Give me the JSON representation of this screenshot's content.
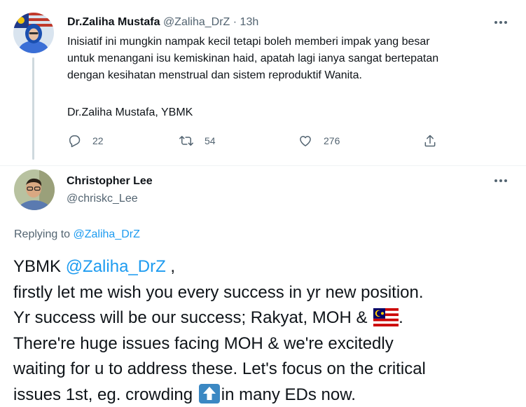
{
  "parent_tweet": {
    "author_name": "Dr.Zaliha Mustafa",
    "author_handle": "@Zaliha_DrZ",
    "separator": "·",
    "time": "13h",
    "text_lines": [
      "Inisiatif ini mungkin nampak kecil tetapi boleh memberi impak yang besar",
      "untuk menangani isu kemiskinan haid, apatah lagi ianya sangat bertepatan",
      "dengan kesihatan menstrual dan sistem reproduktif Wanita."
    ],
    "signature": "Dr.Zaliha Mustafa, YBMK",
    "actions": {
      "reply_count": "22",
      "retweet_count": "54",
      "like_count": "276"
    }
  },
  "reply_tweet": {
    "author_name": "Christopher Lee",
    "author_handle": "@chriskc_Lee",
    "replying_prefix": "Replying to ",
    "replying_to": "@Zaliha_DrZ",
    "line1_prefix": "YBMK ",
    "line1_mention": "@Zaliha_DrZ",
    "line1_suffix": " ,",
    "line2": "firstly let me wish you every success in yr new position.",
    "line3_text": "Yr success will be our success; Rakyat, MOH & ",
    "line3_end": ".",
    "line4": "There're huge issues facing MOH & we're excitedly",
    "line5": "waiting for u to address these. Let's focus on the critical",
    "line6_before": "issues 1st, eg. crowding ",
    "line6_after": "in many EDs now."
  },
  "icons": {
    "more": "more-horizontal-icon",
    "reply": "reply-icon",
    "retweet": "retweet-icon",
    "like": "heart-icon",
    "share": "share-icon",
    "flag": "malaysia-flag-emoji",
    "arrow": "up-arrow-emoji"
  },
  "colors": {
    "accent": "#1d9bf0",
    "text_primary": "#0f1419",
    "text_secondary": "#536471",
    "thread_line": "#cfd9de"
  }
}
